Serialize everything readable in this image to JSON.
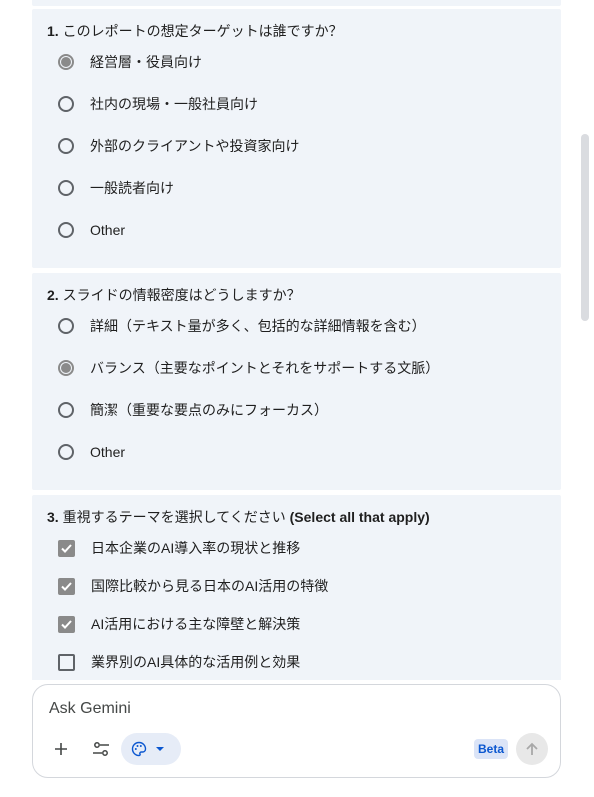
{
  "questions": [
    {
      "number": "1.",
      "text": "このレポートの想定ターゲットは誰ですか？",
      "suffix": "",
      "type": "radio",
      "options": [
        {
          "label": "経営層・役員向け",
          "checked": true
        },
        {
          "label": "社内の現場・一般社員向け",
          "checked": false
        },
        {
          "label": "外部のクライアントや投資家向け",
          "checked": false
        },
        {
          "label": "一般読者向け",
          "checked": false
        },
        {
          "label": "Other",
          "checked": false
        }
      ]
    },
    {
      "number": "2.",
      "text": "スライドの情報密度はどうしますか？",
      "suffix": "",
      "type": "radio",
      "options": [
        {
          "label": "詳細（テキスト量が多く、包括的な詳細情報を含む）",
          "checked": false
        },
        {
          "label": "バランス（主要なポイントとそれをサポートする文脈）",
          "checked": true
        },
        {
          "label": "簡潔（重要な要点のみにフォーカス）",
          "checked": false
        },
        {
          "label": "Other",
          "checked": false
        }
      ]
    },
    {
      "number": "3.",
      "text": "重視するテーマを選択してください",
      "suffix": "(Select all that apply)",
      "type": "checkbox",
      "options": [
        {
          "label": "日本企業のAI導入率の現状と推移",
          "checked": true
        },
        {
          "label": "国際比較から見る日本のAI活用の特徴",
          "checked": true
        },
        {
          "label": "AI活用における主な障壁と解決策",
          "checked": true
        },
        {
          "label": "業界別のAI具体的な活用例と効果",
          "checked": false
        }
      ]
    }
  ],
  "input": {
    "placeholder": "Ask Gemini",
    "beta_label": "Beta"
  },
  "icons": {
    "add": "plus-icon",
    "tools": "tune-icon",
    "theme": "palette-icon",
    "dropdown": "chevron-down-icon",
    "send": "arrow-up-icon"
  },
  "colors": {
    "card_bg": "#f0f4f9",
    "accent": "#0b57d0",
    "beta_bg": "#dbe4f7",
    "selected": "#8a8a8a"
  }
}
